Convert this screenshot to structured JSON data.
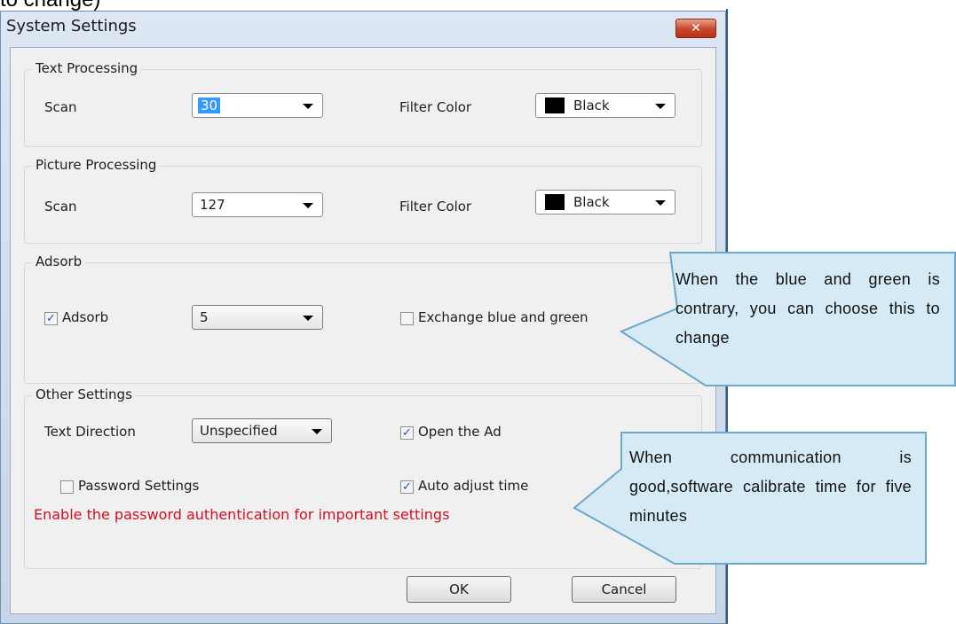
{
  "background_text": "to change)",
  "window": {
    "title": "System Settings",
    "close_label": "✕"
  },
  "text_processing": {
    "group_label": "Text Processing",
    "scan_label": "Scan",
    "scan_value": "30",
    "filter_label": "Filter Color",
    "filter_value": "Black"
  },
  "picture_processing": {
    "group_label": "Picture Processing",
    "scan_label": "Scan",
    "scan_value": "127",
    "filter_label": "Filter Color",
    "filter_value": "Black"
  },
  "adsorb": {
    "group_label": "Adsorb",
    "adsorb_checkbox_label": "Adsorb",
    "adsorb_checked": true,
    "adsorb_value": "5",
    "exchange_label": "Exchange blue and green",
    "exchange_checked": false
  },
  "other_settings": {
    "group_label": "Other Settings",
    "direction_label": "Text Direction",
    "direction_value": "Unspecified",
    "open_ad_label": "Open the Ad",
    "open_ad_checked": true,
    "password_label": "Password Settings",
    "password_checked": false,
    "auto_adjust_label": "Auto adjust time",
    "auto_adjust_checked": true,
    "password_hint": "Enable the password authentication for important settings"
  },
  "buttons": {
    "ok": "OK",
    "cancel": "Cancel"
  },
  "callouts": {
    "exchange_tip": "When the blue and green is contrary, you can choose this to change",
    "time_tip": "When communication is good,software calibrate time for five minutes"
  },
  "colors": {
    "callout_fill": "#d6eaf6",
    "callout_border": "#6aa8c9",
    "hint_red": "#d01020",
    "check_blue": "#1f52b8"
  }
}
